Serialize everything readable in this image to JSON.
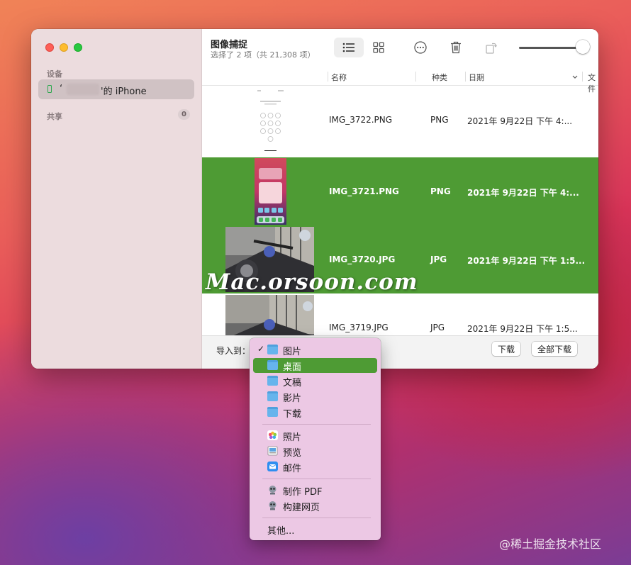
{
  "sidebar": {
    "section_devices": "设备",
    "device_name": "'的 iPhone",
    "device_prefix": "‘",
    "section_shared": "共享",
    "shared_count": "0"
  },
  "main": {
    "title": "图像捕捉",
    "subtitle": "选择了 2 项（共 21,308 项）",
    "columns": {
      "name": "名称",
      "kind": "种类",
      "date": "日期",
      "file": "文件"
    },
    "rows": [
      {
        "name": "IMG_3722.PNG",
        "kind": "PNG",
        "date": "2021年 9月22日 下午 4:...",
        "selected": false
      },
      {
        "name": "IMG_3721.PNG",
        "kind": "PNG",
        "date": "2021年 9月22日 下午 4:...",
        "selected": true
      },
      {
        "name": "IMG_3720.JPG",
        "kind": "JPG",
        "date": "2021年 9月22日 下午 1:5...",
        "selected": true
      },
      {
        "name": "IMG_3719.JPG",
        "kind": "JPG",
        "date": "2021年 9月22日 下午 1:5...",
        "selected": false
      }
    ],
    "import_label": "导入到：",
    "download_label": "下载",
    "download_all_label": "全部下载"
  },
  "menu": {
    "items": [
      {
        "label": "图片",
        "checked": true,
        "icon": "folder-icon"
      },
      {
        "label": "桌面",
        "highlighted": true,
        "icon": "folder-icon"
      },
      {
        "label": "文稿",
        "icon": "folder-icon"
      },
      {
        "label": "影片",
        "icon": "folder-icon"
      },
      {
        "label": "下载",
        "icon": "folder-icon"
      },
      {
        "label": "照片",
        "icon": "photos-icon"
      },
      {
        "label": "预览",
        "icon": "preview-icon"
      },
      {
        "label": "邮件",
        "icon": "mail-icon"
      },
      {
        "label": "制作 PDF",
        "icon": "automator-icon"
      },
      {
        "label": "构建网页",
        "icon": "automator-icon"
      },
      {
        "label": "其他...",
        "icon": ""
      }
    ],
    "check_mark": "✓"
  },
  "watermark": "Mac.orsoon.com",
  "credit": "@稀土掘金技术社区",
  "colors": {
    "selection": "#4e9b34",
    "menu_bg": "#ecc8e4",
    "sidebar_bg": "#ecdcde"
  }
}
